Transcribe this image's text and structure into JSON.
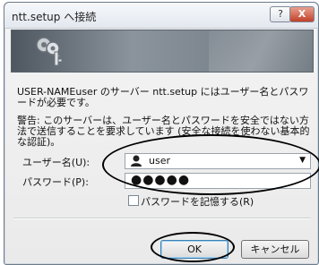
{
  "window": {
    "title": "ntt.setup へ接続",
    "help_label": "?",
    "close_label": "X"
  },
  "message": {
    "line1": "USER-NAMEuser のサーバー ntt.setup にはユーザー名とパスワードが必要です。",
    "warning": "警告: このサーバーは、ユーザー名とパスワードを安全ではない方法で送信することを要求しています (安全な接続を使わない基本的な認証)。"
  },
  "form": {
    "username_label": "ユーザー名(U):",
    "username_value": "user",
    "password_label": "パスワード(P):",
    "password_value": "●●●●●",
    "remember_label": "パスワードを記憶する(R)",
    "remember_checked": false
  },
  "buttons": {
    "ok": "OK",
    "cancel": "キャンセル"
  },
  "icons": {
    "banner": "keys-icon",
    "user": "user-icon",
    "dropdown": "chevron-down-icon"
  }
}
